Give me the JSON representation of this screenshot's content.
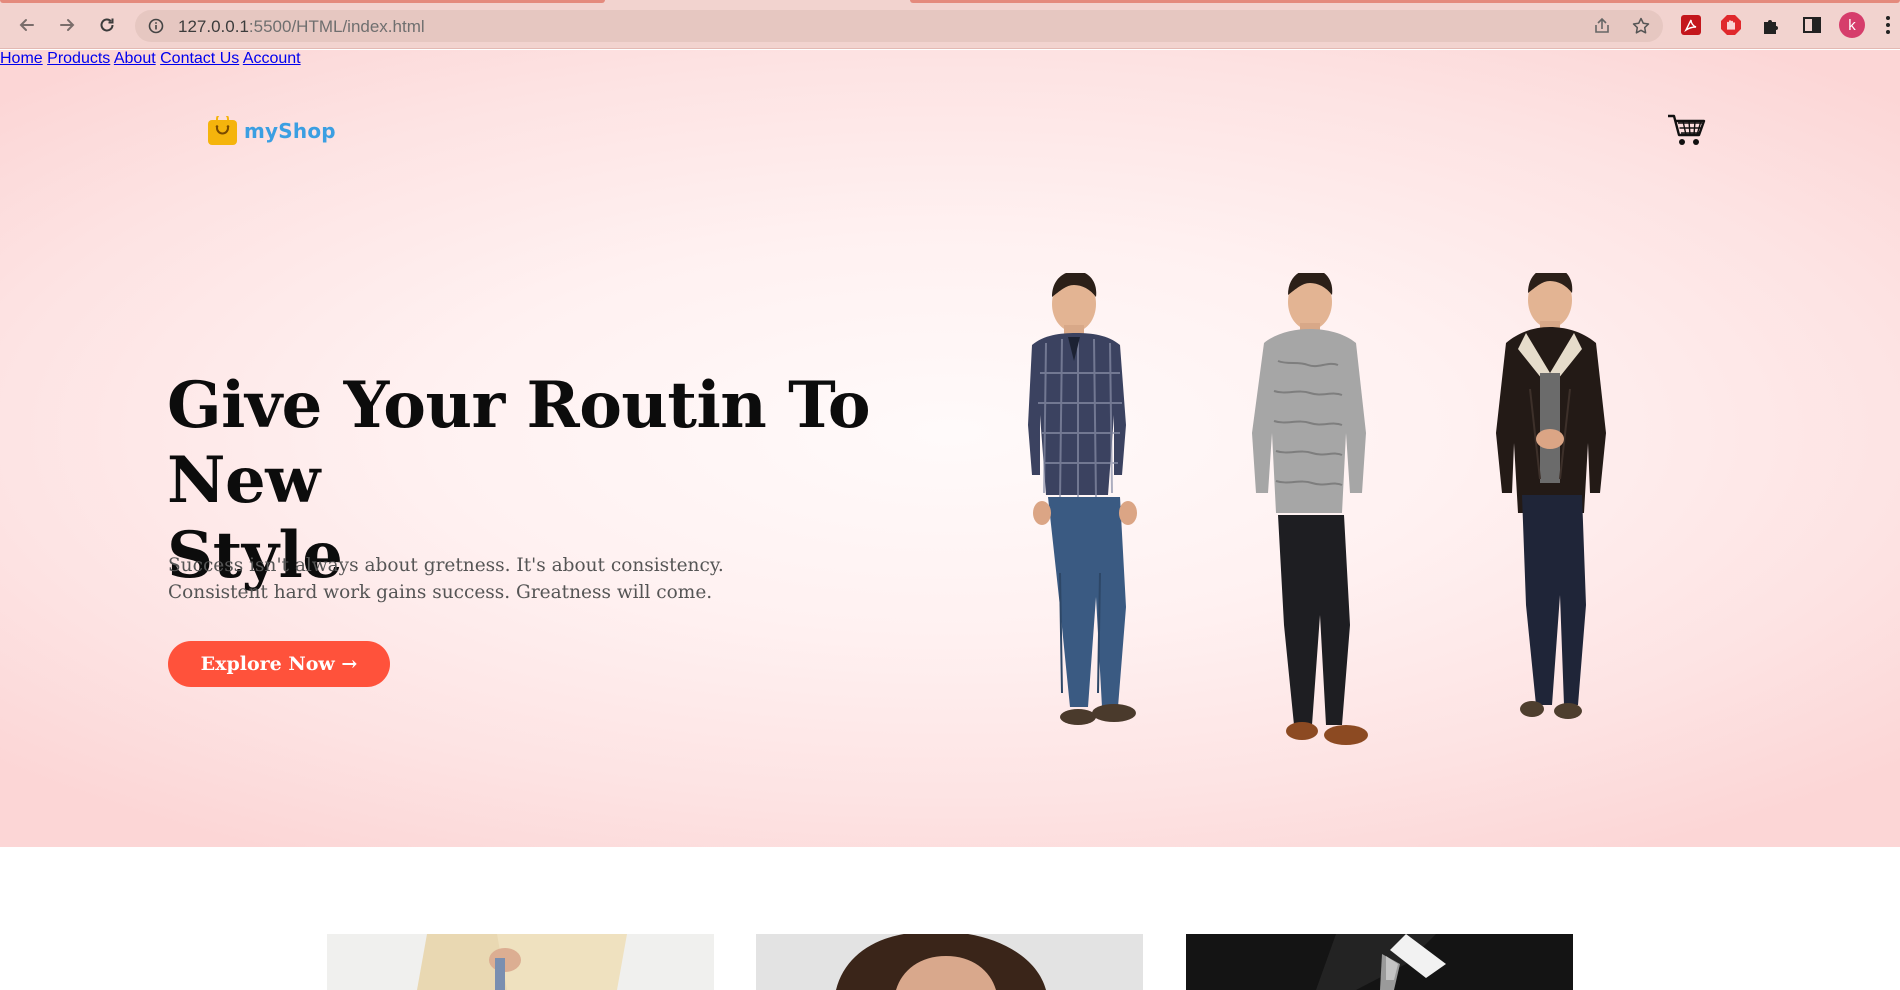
{
  "browser": {
    "url_host": "127.0.0.1",
    "url_rest": ":5500/HTML/index.html",
    "avatar_letter": "k"
  },
  "header": {
    "logo_text": "myShop",
    "nav": [
      "Home",
      "Products",
      "About",
      "Contact Us",
      "Account"
    ],
    "cart_icon": "cart-icon"
  },
  "hero": {
    "title_line1": "Give Your Routin To New",
    "title_line2": "Style",
    "subtitle_line1": "Success isn't always about gretness. It's about consistency.",
    "subtitle_line2": "Consistent hard work gains success. Greatness will come.",
    "button_label": "Explore Now →"
  },
  "models": [
    {
      "outfit": "plaid shirt and blue jeans"
    },
    {
      "outfit": "grey knit sweater and black jeans"
    },
    {
      "outfit": "black leather jacket and dark jeans"
    }
  ],
  "colors": {
    "accent": "#ff523b",
    "logo_blue": "#3b9fe2",
    "logo_bag": "#f5b40c",
    "hero_edge": "#fcd6d6"
  }
}
